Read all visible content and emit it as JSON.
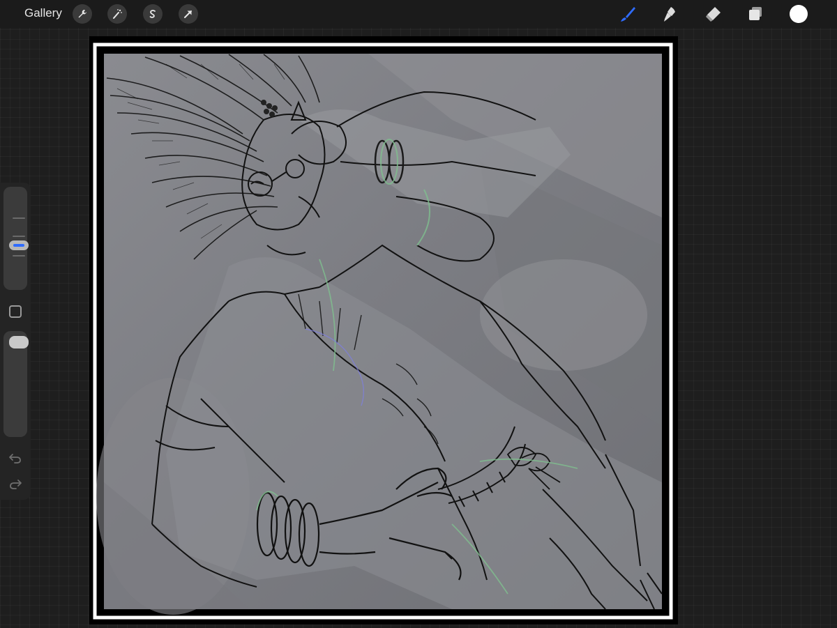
{
  "toolbar": {
    "gallery_label": "Gallery",
    "left_tools": [
      "wrench-icon",
      "magic-wand-icon",
      "selection-icon",
      "transform-arrow-icon"
    ],
    "right_tools": [
      "brush-icon",
      "smudge-icon",
      "eraser-icon",
      "layers-icon"
    ],
    "active_tool": "brush",
    "accent_color": "#2f6cff",
    "current_color": "#ffffff"
  },
  "sidebar": {
    "brush_size_level": 0.55,
    "opacity_level": 1.0,
    "buttons": [
      "modify-square-icon",
      "undo-icon",
      "redo-icon"
    ]
  },
  "canvas": {
    "content": "sketch-artwork"
  }
}
